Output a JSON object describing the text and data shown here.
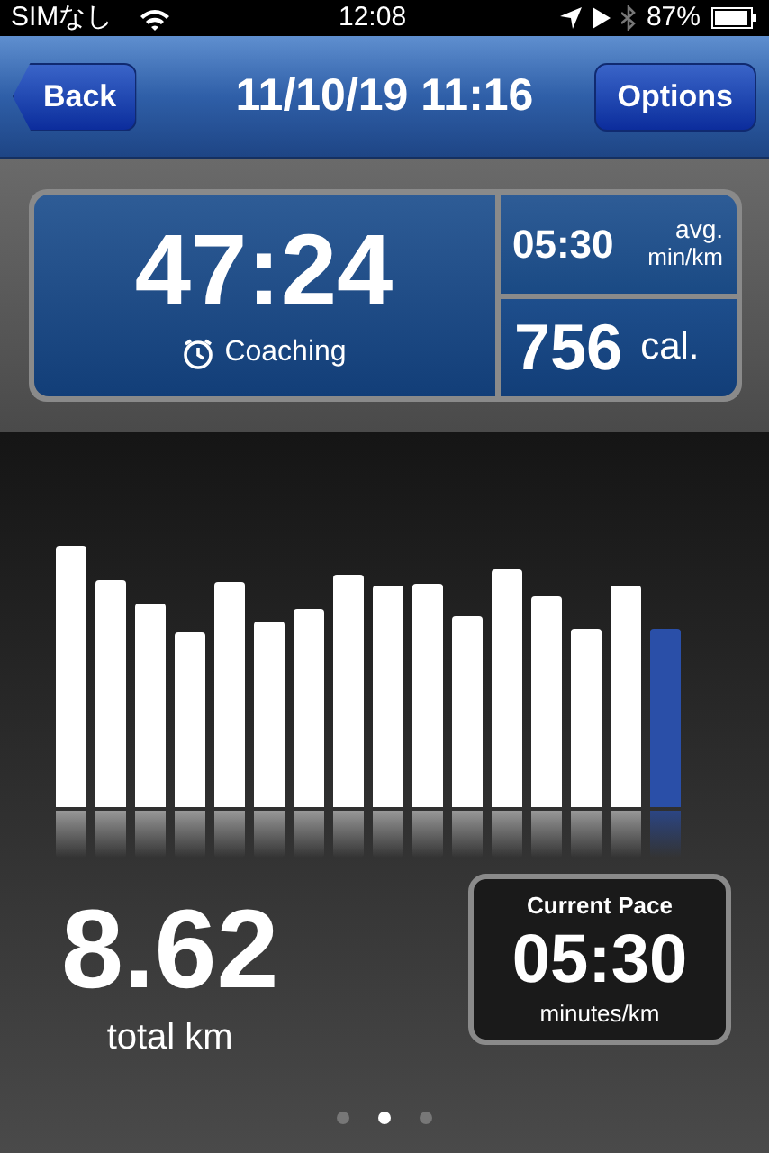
{
  "status_bar": {
    "carrier": "SIMなし",
    "time": "12:08",
    "battery": "87%"
  },
  "nav_bar": {
    "back": "Back",
    "title": "11/10/19 11:16",
    "options": "Options"
  },
  "summary": {
    "duration": "47:24",
    "mode": "Coaching",
    "avg_pace": "05:30",
    "avg_label": "avg.",
    "avg_unit": "min/km",
    "calories": "756",
    "calories_unit": "cal."
  },
  "pace_bars": [
    {
      "selected": false
    },
    {
      "selected": false
    },
    {
      "selected": false
    },
    {
      "selected": false
    },
    {
      "selected": false
    },
    {
      "selected": false
    },
    {
      "selected": false
    },
    {
      "selected": false
    },
    {
      "selected": false
    },
    {
      "selected": false
    },
    {
      "selected": false
    },
    {
      "selected": false
    },
    {
      "selected": false
    },
    {
      "selected": false
    },
    {
      "selected": false
    },
    {
      "selected": true
    }
  ],
  "distance": {
    "value": "8.62",
    "unit": "total km"
  },
  "current_pace": {
    "label": "Current Pace",
    "value": "05:30",
    "unit": "minutes/km"
  },
  "pager": [
    {
      "selected": false
    },
    {
      "selected": true
    },
    {
      "selected": false
    }
  ]
}
